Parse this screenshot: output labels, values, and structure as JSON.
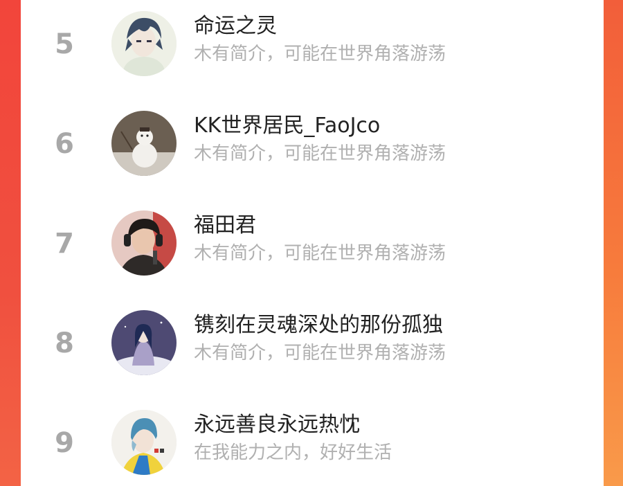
{
  "ranking": {
    "items": [
      {
        "rank": "5",
        "name": "命运之灵",
        "bio": "木有简介，可能在世界角落游荡",
        "avatar": "anime-boy-avatar"
      },
      {
        "rank": "6",
        "name": "KK世界居民_FaoJco",
        "bio": "木有简介，可能在世界角落游荡",
        "avatar": "snowman-avatar"
      },
      {
        "rank": "7",
        "name": "福田君",
        "bio": "木有简介，可能在世界角落游荡",
        "avatar": "boy-headphones-avatar"
      },
      {
        "rank": "8",
        "name": "镌刻在灵魂深处的那份孤独",
        "bio": "木有简介，可能在世界角落游荡",
        "avatar": "girl-night-avatar"
      },
      {
        "rank": "9",
        "name": "永远善良永远热忱",
        "bio": "在我能力之内，好好生活",
        "avatar": "beanie-boy-avatar"
      }
    ]
  }
}
